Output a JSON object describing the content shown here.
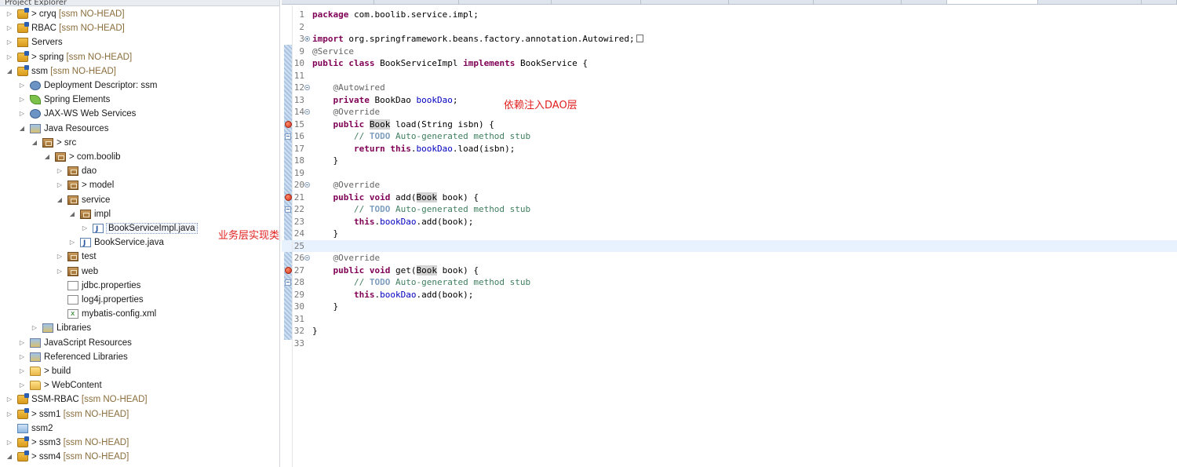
{
  "explorer": {
    "title": "Project Explorer",
    "items": [
      {
        "name": "cryq",
        "git": "[ssm NO-HEAD]",
        "prefix": "> ",
        "depth": 0,
        "expanded": false,
        "icon": "project"
      },
      {
        "name": "RBAC",
        "git": "[ssm NO-HEAD]",
        "prefix": "",
        "depth": 0,
        "expanded": false,
        "icon": "project"
      },
      {
        "name": "Servers",
        "git": "",
        "prefix": "",
        "depth": 0,
        "expanded": false,
        "icon": "server"
      },
      {
        "name": "spring",
        "git": "[ssm NO-HEAD]",
        "prefix": "> ",
        "depth": 0,
        "expanded": false,
        "icon": "project"
      },
      {
        "name": "ssm",
        "git": "[ssm NO-HEAD]",
        "prefix": "",
        "depth": 0,
        "expanded": true,
        "icon": "project"
      },
      {
        "name": "Deployment Descriptor: ssm",
        "git": "",
        "prefix": "",
        "depth": 1,
        "expanded": false,
        "icon": "gear"
      },
      {
        "name": "Spring Elements",
        "git": "",
        "prefix": "",
        "depth": 1,
        "expanded": false,
        "icon": "leaf"
      },
      {
        "name": "JAX-WS Web Services",
        "git": "",
        "prefix": "",
        "depth": 1,
        "expanded": false,
        "icon": "gear"
      },
      {
        "name": "Java Resources",
        "git": "",
        "prefix": "",
        "depth": 1,
        "expanded": true,
        "icon": "lib"
      },
      {
        "name": "src",
        "git": "",
        "prefix": "> ",
        "depth": 2,
        "expanded": true,
        "icon": "package"
      },
      {
        "name": "com.boolib",
        "git": "",
        "prefix": "> ",
        "depth": 3,
        "expanded": true,
        "icon": "package"
      },
      {
        "name": "dao",
        "git": "",
        "prefix": "",
        "depth": 4,
        "expanded": false,
        "icon": "package"
      },
      {
        "name": "model",
        "git": "",
        "prefix": "> ",
        "depth": 4,
        "expanded": false,
        "icon": "package"
      },
      {
        "name": "service",
        "git": "",
        "prefix": "",
        "depth": 4,
        "expanded": true,
        "icon": "package"
      },
      {
        "name": "impl",
        "git": "",
        "prefix": "",
        "depth": 5,
        "expanded": true,
        "icon": "package"
      },
      {
        "name": "BookServiceImpl.java",
        "git": "",
        "prefix": "",
        "depth": 6,
        "expanded": false,
        "icon": "java",
        "selected": true
      },
      {
        "name": "BookService.java",
        "git": "",
        "prefix": "",
        "depth": 5,
        "expanded": false,
        "icon": "java"
      },
      {
        "name": "test",
        "git": "",
        "prefix": "",
        "depth": 4,
        "expanded": false,
        "icon": "package"
      },
      {
        "name": "web",
        "git": "",
        "prefix": "",
        "depth": 4,
        "expanded": false,
        "icon": "package"
      },
      {
        "name": "jdbc.properties",
        "git": "",
        "prefix": "",
        "depth": 4,
        "leaf": true,
        "icon": "file"
      },
      {
        "name": "log4j.properties",
        "git": "",
        "prefix": "",
        "depth": 4,
        "leaf": true,
        "icon": "file"
      },
      {
        "name": "mybatis-config.xml",
        "git": "",
        "prefix": "",
        "depth": 4,
        "leaf": true,
        "icon": "xml"
      },
      {
        "name": "Libraries",
        "git": "",
        "prefix": "",
        "depth": 2,
        "expanded": false,
        "icon": "lib"
      },
      {
        "name": "JavaScript Resources",
        "git": "",
        "prefix": "",
        "depth": 1,
        "expanded": false,
        "icon": "lib"
      },
      {
        "name": "Referenced Libraries",
        "git": "",
        "prefix": "",
        "depth": 1,
        "expanded": false,
        "icon": "lib"
      },
      {
        "name": "build",
        "git": "",
        "prefix": "> ",
        "depth": 1,
        "expanded": false,
        "icon": "folder"
      },
      {
        "name": "WebContent",
        "git": "",
        "prefix": "> ",
        "depth": 1,
        "expanded": false,
        "icon": "folder"
      },
      {
        "name": "SSM-RBAC",
        "git": "[ssm NO-HEAD]",
        "prefix": "",
        "depth": 0,
        "expanded": false,
        "icon": "project"
      },
      {
        "name": "ssm1",
        "git": "[ssm NO-HEAD]",
        "prefix": "> ",
        "depth": 0,
        "expanded": false,
        "icon": "project"
      },
      {
        "name": "ssm2",
        "git": "",
        "prefix": "",
        "depth": 0,
        "leaf": true,
        "icon": "plain"
      },
      {
        "name": "ssm3",
        "git": "[ssm NO-HEAD]",
        "prefix": "> ",
        "depth": 0,
        "expanded": false,
        "icon": "project"
      },
      {
        "name": "ssm4",
        "git": "[ssm NO-HEAD]",
        "prefix": "> ",
        "depth": 0,
        "expanded": true,
        "icon": "project"
      }
    ]
  },
  "annotations": {
    "service_impl": "业务层实现类",
    "dao_injection": "依赖注入DAO层"
  },
  "editor": {
    "current_line": 25,
    "lines": [
      {
        "n": 1,
        "html": "<span class='kw'>package</span> com.boolib.service.impl;"
      },
      {
        "n": 2,
        "html": ""
      },
      {
        "n": 3,
        "fold": "plus",
        "html": "<span class='kw'>import</span> org.springframework.beans.factory.annotation.Autowired;<span class='collapsed'></span>"
      },
      {
        "n": 9,
        "html": "<span class='ann'>@Service</span>"
      },
      {
        "n": 10,
        "html": "<span class='kw'>public</span> <span class='kw'>class</span> BookServiceImpl <span class='kw'>implements</span> BookService {"
      },
      {
        "n": 11,
        "html": ""
      },
      {
        "n": 12,
        "fold": "minus",
        "html": "    <span class='ann'>@Autowired</span>"
      },
      {
        "n": 13,
        "html": "    <span class='kw'>private</span> BookDao <span class='fld'>bookDao</span>;"
      },
      {
        "n": 14,
        "fold": "minus",
        "html": "    <span class='ann'>@Override</span>"
      },
      {
        "n": 15,
        "marker": "override",
        "html": "    <span class='kw'>public</span> <span class='occ'>Book</span> load(String isbn) {"
      },
      {
        "n": 16,
        "marker": "task",
        "html": "        <span class='cm'>// </span><span class='todo'>TODO</span><span class='cm'> Auto-generated method stub</span>"
      },
      {
        "n": 17,
        "html": "        <span class='kw'>return</span> <span class='kw'>this</span>.<span class='fld'>bookDao</span>.load(isbn);"
      },
      {
        "n": 18,
        "html": "    }"
      },
      {
        "n": 19,
        "html": ""
      },
      {
        "n": 20,
        "fold": "minus",
        "html": "    <span class='ann'>@Override</span>"
      },
      {
        "n": 21,
        "marker": "override",
        "html": "    <span class='kw'>public</span> <span class='kw'>void</span> add(<span class='occ'>Book</span> book) {"
      },
      {
        "n": 22,
        "marker": "task",
        "html": "        <span class='cm'>// </span><span class='todo'>TODO</span><span class='cm'> Auto-generated method stub</span>"
      },
      {
        "n": 23,
        "html": "        <span class='kw'>this</span>.<span class='fld'>bookDao</span>.add(book);"
      },
      {
        "n": 24,
        "html": "    }"
      },
      {
        "n": 25,
        "html": ""
      },
      {
        "n": 26,
        "fold": "minus",
        "html": "    <span class='ann'>@Override</span>"
      },
      {
        "n": 27,
        "marker": "override",
        "html": "    <span class='kw'>public</span> <span class='kw'>void</span> get(<span class='occ'>Book</span> book) {"
      },
      {
        "n": 28,
        "marker": "task",
        "html": "        <span class='cm'>// </span><span class='todo'>TODO</span><span class='cm'> Auto-generated method stub</span>"
      },
      {
        "n": 29,
        "html": "        <span class='kw'>this</span>.<span class='fld'>bookDao</span>.add(book);"
      },
      {
        "n": 30,
        "html": "    }"
      },
      {
        "n": 31,
        "html": ""
      },
      {
        "n": 32,
        "html": "}"
      },
      {
        "n": 33,
        "html": ""
      }
    ]
  },
  "colors": {
    "keyword": "#7f0055",
    "annotation": "#646464",
    "comment": "#3f7f5f",
    "field": "#0000c0",
    "git_decoration": "#8a6d3b",
    "note_text": "#e02020",
    "current_line": "#e8f2fe"
  }
}
